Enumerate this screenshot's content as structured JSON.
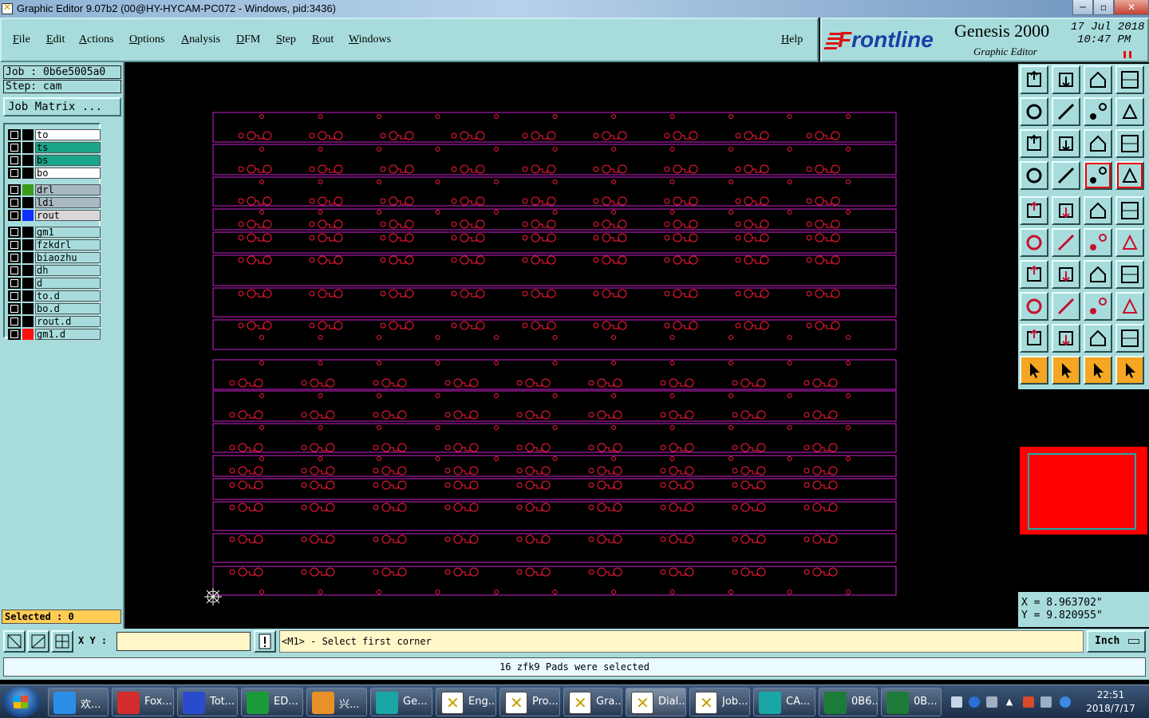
{
  "window": {
    "title": "Graphic Editor 9.07b2 (00@HY-HYCAM-PC072 - Windows, pid:3436)",
    "min_glyph": "─",
    "max_glyph": "▫",
    "close_glyph": "✕"
  },
  "menu": {
    "items": [
      "File",
      "Edit",
      "Actions",
      "Options",
      "Analysis",
      "DFM",
      "Step",
      "Rout",
      "Windows"
    ],
    "help": "Help"
  },
  "brand": {
    "logo_text": "Frontline",
    "product": "Genesis 2000",
    "subtitle": "Graphic Editor",
    "date": "17 Jul 2018",
    "time": "10:47 PM"
  },
  "job": {
    "job_label": "Job : 0b6e5005a0",
    "step_label": "Step: cam",
    "matrix_button": "Job Matrix ..."
  },
  "layers": [
    {
      "name": "to",
      "color": "#000000",
      "bg": "#ffffff"
    },
    {
      "name": "ts",
      "color": "#000000",
      "bg": "#1aa58a"
    },
    {
      "name": "bs",
      "color": "#000000",
      "bg": "#1aa58a"
    },
    {
      "name": "bo",
      "color": "#000000",
      "bg": "#ffffff"
    },
    {
      "name": "drl",
      "color": "#3c9a1a",
      "bg": "#a9b9c4"
    },
    {
      "name": "ldi",
      "color": "#000000",
      "bg": "#a9b9c4"
    },
    {
      "name": "rout",
      "color": "#1030ff",
      "bg": "#d8d8d8"
    },
    {
      "name": "gm1",
      "color": "#000000",
      "bg": "#a8dcdc"
    },
    {
      "name": "fzkdrl",
      "color": "#000000",
      "bg": "#a8dcdc"
    },
    {
      "name": "biaozhu",
      "color": "#000000",
      "bg": "#a8dcdc"
    },
    {
      "name": "dh",
      "color": "#000000",
      "bg": "#a8dcdc"
    },
    {
      "name": "d",
      "color": "#000000",
      "bg": "#a8dcdc"
    },
    {
      "name": "to.d",
      "color": "#000000",
      "bg": "#a8dcdc"
    },
    {
      "name": "bo.d",
      "color": "#000000",
      "bg": "#a8dcdc"
    },
    {
      "name": "rout.d",
      "color": "#000000",
      "bg": "#a8dcdc"
    },
    {
      "name": "gm1.d",
      "color": "#ff1010",
      "bg": "#a8dcdc"
    }
  ],
  "selection": {
    "label": "Selected : 0"
  },
  "coords": {
    "x": "X = 8.963702\"",
    "y": "Y = 9.820955\""
  },
  "command": {
    "xy_label": "X Y :",
    "xy_value": "",
    "prompt": "<M1> - Select first corner",
    "units": "Inch",
    "status": "16 zfk9 Pads were selected"
  },
  "colors": {
    "panel": "#a8dcdc",
    "board_outline": "#cc22cc",
    "pad": "#ff1a3a",
    "preview_fill": "#ff0000"
  },
  "tools": [
    "move-step-up-icon",
    "move-step-down-icon",
    "home-icon",
    "window-layout-icon",
    "pan-left-icon",
    "pan-right-icon",
    "undo-icon",
    "redo-icon",
    "zoom-fit-icon",
    "zoom-home-icon",
    "zoom-1-2-icon",
    "help-icon",
    "snap-settings-icon",
    "grid-icon",
    "layer-red-icon",
    "layer-red-alt-icon",
    "pad-icon",
    "line-icon",
    "ruler-icon",
    "circle-icon",
    "node-icon",
    "cross-node-icon",
    "line-node-icon",
    "line-node-alt-icon",
    "angle-icon",
    "slash-icon",
    "rotate-icon",
    "mirror-icon",
    "measure-icon",
    "measure-line-icon",
    "measure-h-icon",
    "shapes-icon",
    "triangle-icon",
    "triangle-plus-icon",
    "triangle-arrow-icon",
    "triangle-up-icon",
    "pointer-icon",
    "pointer-box-icon",
    "pointer-circle-icon",
    "pointer-net-icon"
  ],
  "taskbar": {
    "items": [
      {
        "label": "欢...",
        "icon": "ie-icon",
        "color": "#2a8ee8"
      },
      {
        "label": "Fox...",
        "icon": "foxit-icon",
        "color": "#d32d2d"
      },
      {
        "label": "Tot...",
        "icon": "floppy-icon",
        "color": "#2a4ccc"
      },
      {
        "label": "ED...",
        "icon": "editplus-icon",
        "color": "#1a9a3a"
      },
      {
        "label": "兴...",
        "icon": "shell-icon",
        "color": "#e8902a"
      },
      {
        "label": "Ge...",
        "icon": "eye-icon",
        "color": "#1aa6a6"
      },
      {
        "label": "Eng...",
        "icon": "genesis-icon",
        "color": "#ffffff"
      },
      {
        "label": "Pro...",
        "icon": "genesis-icon",
        "color": "#ffffff"
      },
      {
        "label": "Gra...",
        "icon": "genesis-icon",
        "color": "#ffffff"
      },
      {
        "label": "Dial...",
        "icon": "genesis-icon",
        "color": "#ffffff"
      },
      {
        "label": "Job...",
        "icon": "genesis-icon",
        "color": "#ffffff"
      },
      {
        "label": "CA...",
        "icon": "cam-icon",
        "color": "#1aa6a6"
      },
      {
        "label": "0B6...",
        "icon": "excel-icon",
        "color": "#1d7b3a"
      },
      {
        "label": "0B...",
        "icon": "excel-icon",
        "color": "#1d7b3a"
      }
    ],
    "clock_time": "22:51",
    "clock_date": "2018/7/17"
  }
}
